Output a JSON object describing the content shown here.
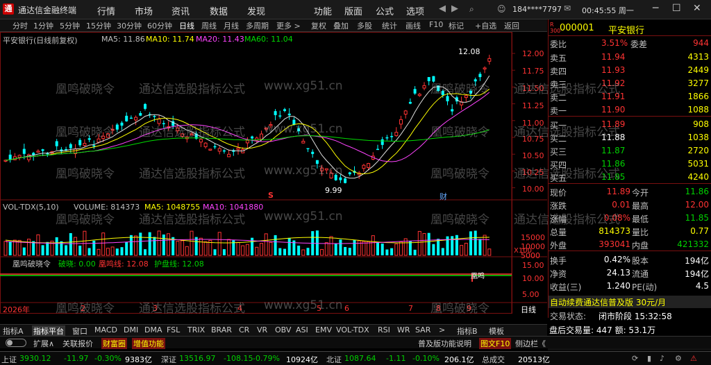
{
  "app": {
    "title": "通达信金融终端",
    "menus": [
      "行情",
      "市场",
      "资讯",
      "数据",
      "发现",
      "功能",
      "版面",
      "公式",
      "选项"
    ],
    "user": "184****7797",
    "clock": "00:45:55 周一"
  },
  "toolbar": {
    "items": [
      "分时",
      "1分钟",
      "5分钟",
      "15分钟",
      "30分钟",
      "60分钟",
      "日线",
      "周线",
      "月线",
      "多周期",
      "更多 >",
      "复权",
      "叠加",
      "多股",
      "统计",
      "画线",
      "F10",
      "标记",
      "+自选",
      "返回"
    ],
    "active": "日线"
  },
  "main_chart": {
    "legend": [
      {
        "text": "平安银行(日线前复权)",
        "color": "#c0c0c0"
      },
      {
        "text": "MA5: 11.86",
        "color": "#c0c0c0"
      },
      {
        "text": "MA10: 11.74",
        "color": "#ffff00"
      },
      {
        "text": "MA20: 11.43",
        "color": "#ff44ff"
      },
      {
        "text": "MA60: 11.04",
        "color": "#00dd00"
      }
    ],
    "yaxis": [
      "12.00",
      "11.75",
      "11.50",
      "11.25",
      "11.00",
      "10.75",
      "10.50",
      "10.25",
      "10.00"
    ],
    "high_label": "12.08",
    "low_label": "9.99",
    "marker_s": "S",
    "marker_cai": "财"
  },
  "volume_chart": {
    "legend": [
      {
        "text": "VOL-TDX(5,10)",
        "color": "#c0c0c0"
      },
      {
        "text": "VOLUME: 814373",
        "color": "#c0c0c0"
      },
      {
        "text": "MA5: 1048755",
        "color": "#ffff00"
      },
      {
        "text": "MA10: 1041880",
        "color": "#ff44ff"
      }
    ],
    "yaxis": [
      "15000",
      "10000",
      "5000"
    ],
    "unit": "X100"
  },
  "indicator_chart": {
    "legend": [
      {
        "text": "凰鸣破晓令",
        "color": "#c0c0c0"
      },
      {
        "text": "破晓: 0.00",
        "color": "#00dd00"
      },
      {
        "text": "凰鸣线: 12.08",
        "color": "#ff3333"
      },
      {
        "text": "护盘线: 12.08",
        "color": "#00dd00"
      }
    ],
    "yaxis": [
      "15.00",
      "10.00",
      "5.00"
    ],
    "marker": "凰鸣"
  },
  "xaxis": {
    "labels": [
      "2026年",
      "2",
      "3",
      "4",
      "5",
      "6",
      "7",
      "8",
      "9"
    ],
    "period": "日线"
  },
  "quote": {
    "code": "000001",
    "name": "平安银行",
    "weibi_label": "委比",
    "weibi": "3.51%",
    "weicha_label": "委差",
    "weicha": "944",
    "asks": [
      {
        "label": "卖五",
        "price": "11.94",
        "vol": "4313"
      },
      {
        "label": "卖四",
        "price": "11.93",
        "vol": "2449"
      },
      {
        "label": "卖三",
        "price": "11.92",
        "vol": "3277"
      },
      {
        "label": "卖二",
        "price": "11.91",
        "vol": "1866"
      },
      {
        "label": "卖一",
        "price": "11.90",
        "vol": "1088"
      }
    ],
    "bids": [
      {
        "label": "买一",
        "price": "11.89",
        "vol": "908"
      },
      {
        "label": "买二",
        "price": "11.88",
        "vol": "1038"
      },
      {
        "label": "买三",
        "price": "11.87",
        "vol": "2720"
      },
      {
        "label": "买四",
        "price": "11.86",
        "vol": "5031"
      },
      {
        "label": "买五",
        "price": "11.85",
        "vol": "4240"
      }
    ],
    "stats": [
      {
        "l1": "现价",
        "v1": "11.89",
        "c1": "red",
        "l2": "今开",
        "v2": "11.86",
        "c2": "green"
      },
      {
        "l1": "涨跌",
        "v1": "0.01",
        "c1": "red",
        "l2": "最高",
        "v2": "12.00",
        "c2": "red"
      },
      {
        "l1": "涨幅",
        "v1": "0.08%",
        "c1": "red",
        "l2": "最低",
        "v2": "11.85",
        "c2": "green"
      },
      {
        "l1": "总量",
        "v1": "814373",
        "c1": "yellow",
        "l2": "量比",
        "v2": "0.77",
        "c2": "yellow"
      },
      {
        "l1": "外盘",
        "v1": "393041",
        "c1": "red",
        "l2": "内盘",
        "v2": "421332",
        "c2": "green"
      }
    ],
    "stats2": [
      {
        "l1": "换手",
        "v1": "0.42%",
        "l2": "股本",
        "v2": "194亿"
      },
      {
        "l1": "净资",
        "v1": "24.13",
        "l2": "流通",
        "v2": "194亿"
      },
      {
        "l1": "收益(三)",
        "v1": "1.240",
        "l2": "PE(动)",
        "v2": "4.5"
      }
    ],
    "promo": "自动续费通达信普及版 30元/月",
    "trade_status_label": "交易状态:",
    "trade_status": "闭市阶段 15:32:58",
    "after_hours": "盘后交易量: 447 额: 53.1万",
    "right_tabs": [
      "笔",
      "逐",
      "价",
      "细",
      "势",
      "联",
      "主",
      "筹",
      "值",
      "多"
    ]
  },
  "tabs": {
    "row1": [
      "指标A",
      "指标平台",
      "窗口",
      "MACD",
      "DMI",
      "DMA",
      "FSL",
      "TRIX",
      "BRAR",
      "CR",
      "VR",
      "OBV",
      "ASI",
      "EMV",
      "VOL-TDX",
      "RSI",
      "WR",
      "SAR",
      ">",
      "指标B",
      "模板"
    ],
    "row1_active": "指标平台",
    "row2_left": [
      "扩展∧",
      "关联报价",
      "财富圈",
      "增值功能"
    ],
    "row2_right": [
      "普及版功能说明",
      "图文F10",
      "侧边栏《"
    ]
  },
  "statusbar": {
    "sh_label": "上证",
    "sh_val": "3930.12",
    "sh_chg": "-11.97",
    "sh_pct": "-0.30%",
    "sh_amt": "9383亿",
    "sz_label": "深证",
    "sz_val": "13516.97",
    "sz_chg": "-108.15",
    "sz_pct": "-0.79%",
    "sz_amt": "10924亿",
    "bz_label": "北证",
    "bz_val": "1087.64",
    "bz_chg": "-1.11",
    "bz_pct": "-0.10%",
    "bz_amt": "206.1亿",
    "total_label": "总成交",
    "total": "20513亿"
  },
  "watermark": {
    "text1": "凰鸣破晓令",
    "text2": "通达信选股指标公式",
    "text3": "www.xg51.cn"
  },
  "colors": {
    "up": "#ff3333",
    "down": "#00ffff",
    "ma5": "#e0e0e0",
    "ma10": "#ffff00",
    "ma20": "#ff44ff",
    "ma60": "#00dd00",
    "grid": "#7a1010"
  }
}
